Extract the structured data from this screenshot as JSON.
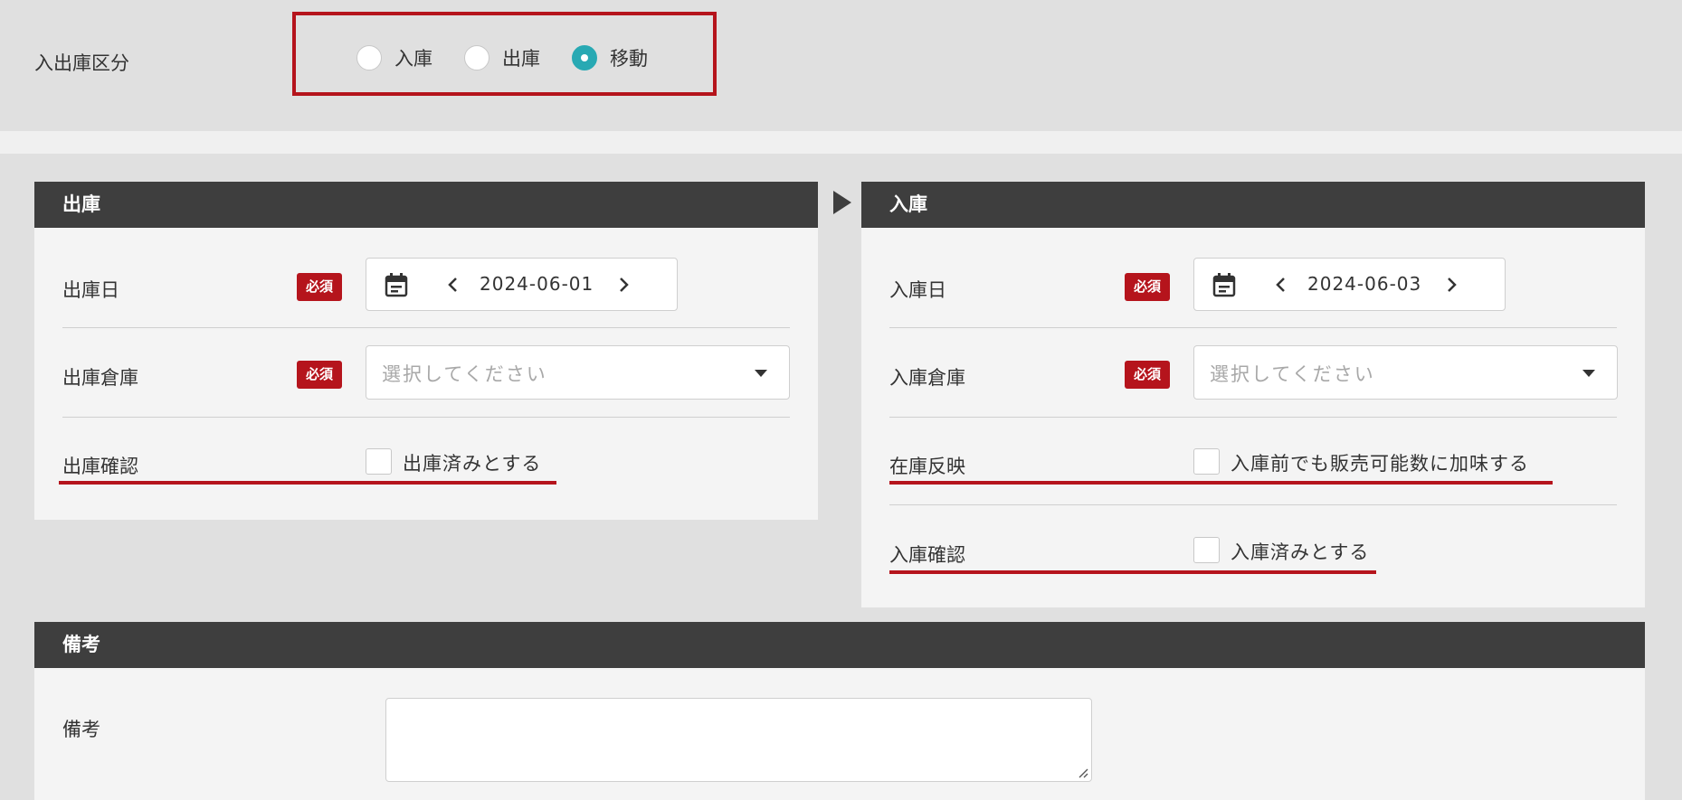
{
  "type_section": {
    "label": "入出庫区分",
    "options": [
      {
        "label": "入庫",
        "selected": false
      },
      {
        "label": "出庫",
        "selected": false
      },
      {
        "label": "移動",
        "selected": true
      }
    ]
  },
  "outbound": {
    "title": "出庫",
    "date_label": "出庫日",
    "date_value": "2024-06-01",
    "warehouse_label": "出庫倉庫",
    "warehouse_placeholder": "選択してください",
    "confirm_label": "出庫確認",
    "confirm_checkbox_text": "出庫済みとする"
  },
  "inbound": {
    "title": "入庫",
    "date_label": "入庫日",
    "date_value": "2024-06-03",
    "warehouse_label": "入庫倉庫",
    "warehouse_placeholder": "選択してください",
    "reflect_label": "在庫反映",
    "reflect_checkbox_text": "入庫前でも販売可能数に加味する",
    "confirm_label": "入庫確認",
    "confirm_checkbox_text": "入庫済みとする"
  },
  "required_badge": "必須",
  "notes": {
    "title": "備考",
    "label": "備考",
    "value": ""
  },
  "colors": {
    "accent_red": "#b5141c",
    "radio_teal": "#28a9b3",
    "header_dark": "#3e3e3e"
  },
  "icons": [
    "calendar-icon",
    "chevron-left-icon",
    "chevron-right-icon",
    "dropdown-caret-icon",
    "arrow-right-icon",
    "resize-grip-icon"
  ]
}
